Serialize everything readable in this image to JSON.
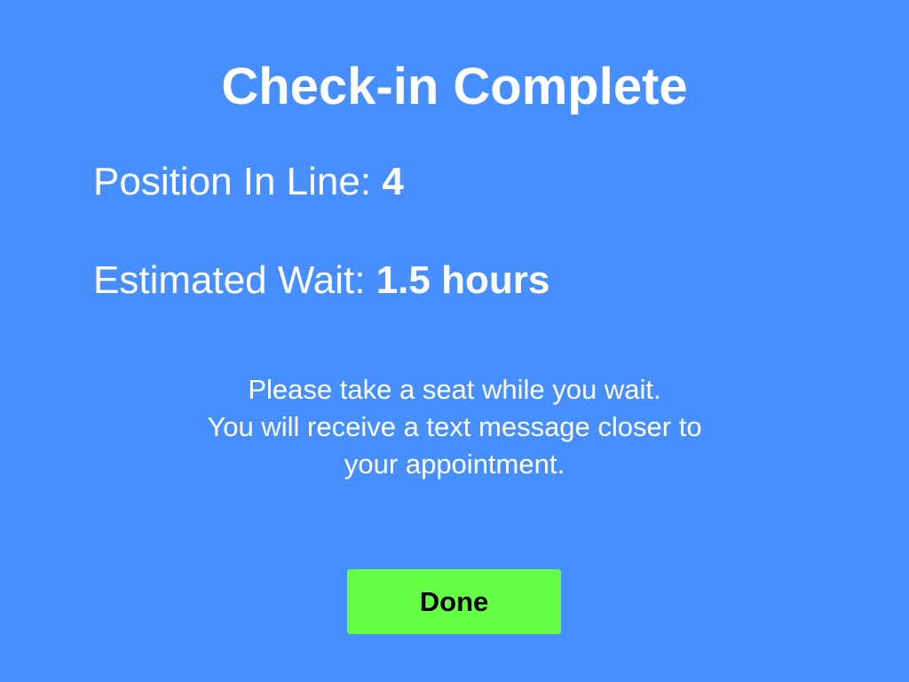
{
  "screen": {
    "title": "Check-in Complete",
    "position": {
      "label": "Position In Line:",
      "value": "4"
    },
    "estimated_wait": {
      "label": "Estimated Wait:",
      "value": "1.5 hours"
    },
    "message_lines": [
      "Please take a seat while you wait.",
      "You will receive a text message closer to",
      "your appointment."
    ],
    "done_button_label": "Done"
  },
  "colors": {
    "background": "#478eff",
    "text": "#ffffff",
    "button": "#65ff45",
    "button_text": "#000000"
  }
}
